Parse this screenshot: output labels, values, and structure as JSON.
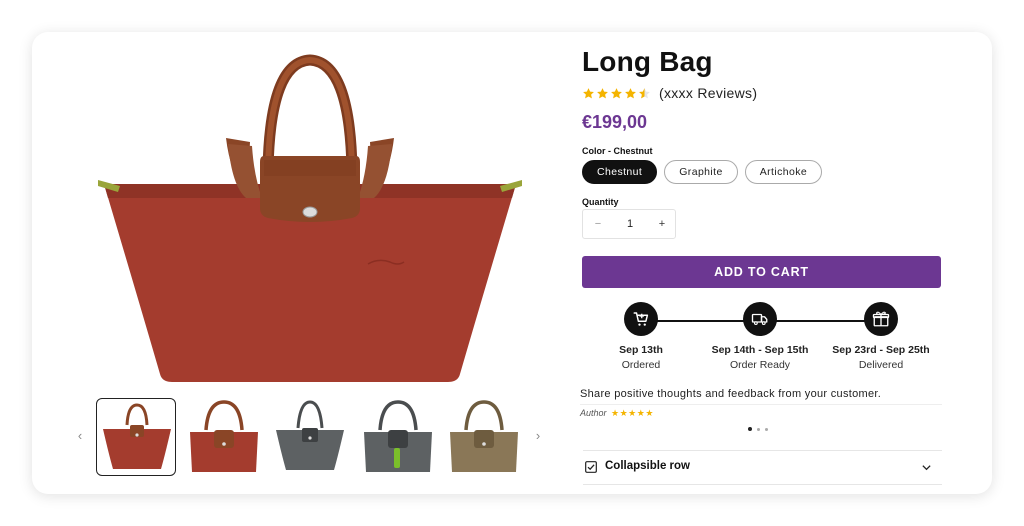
{
  "product": {
    "title": "Long Bag",
    "rating_value": 4.5,
    "rating_max": 5,
    "review_count_text": "(xxxx Reviews)",
    "price": "€199,00"
  },
  "colors": {
    "label": "Color - Chestnut",
    "options": [
      "Chestnut",
      "Graphite",
      "Artichoke"
    ],
    "selected": "Chestnut"
  },
  "quantity": {
    "label": "Quantity",
    "minus": "−",
    "value": "1",
    "plus": "+"
  },
  "cart": {
    "label": "ADD TO CART"
  },
  "timeline": [
    {
      "date": "Sep 13th",
      "status": "Ordered",
      "icon": "cart-icon"
    },
    {
      "date": "Sep 14th - Sep 15th",
      "status": "Order Ready",
      "icon": "truck-icon"
    },
    {
      "date": "Sep 23rd - Sep 25th",
      "status": "Delivered",
      "icon": "gift-icon"
    }
  ],
  "testimonial": {
    "text": "Share positive thoughts and feedback from your customer.",
    "author": "Author",
    "stars": "★★★★★",
    "slides": 3,
    "active_slide": 1
  },
  "collapsible": {
    "label": "Collapsible row"
  },
  "gallery": {
    "prev": "‹",
    "next": "›",
    "thumbnails": [
      "chestnut",
      "chestnut",
      "graphite",
      "graphite",
      "khaki"
    ],
    "active_thumbnail": 0
  },
  "colors_theme": {
    "accent": "#6c3792",
    "star": "#f4b400",
    "bag_chestnut": "#a43c2e",
    "bag_graphite": "#5d6163",
    "bag_khaki": "#8a7757",
    "leather": "#8a4526"
  }
}
